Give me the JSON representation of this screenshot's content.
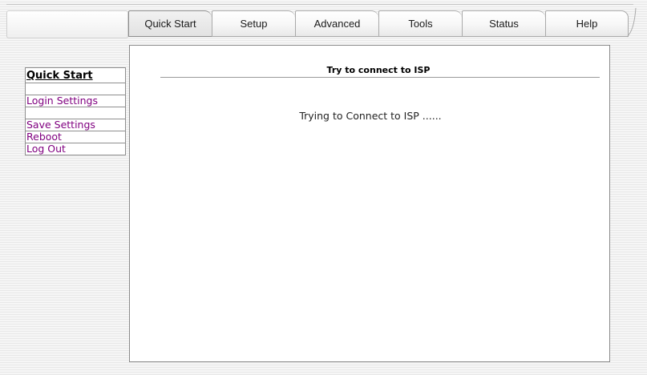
{
  "tabs": [
    {
      "label": "Quick Start",
      "active": true
    },
    {
      "label": "Setup",
      "active": false
    },
    {
      "label": "Advanced",
      "active": false
    },
    {
      "label": "Tools",
      "active": false
    },
    {
      "label": "Status",
      "active": false
    },
    {
      "label": "Help",
      "active": false
    }
  ],
  "sidebar": {
    "heading": "Quick Start",
    "items": [
      {
        "label": "Login Settings"
      },
      {
        "label": "Save Settings"
      },
      {
        "label": "Reboot"
      },
      {
        "label": "Log Out"
      }
    ]
  },
  "main": {
    "title": "Try to connect to ISP",
    "status_message": "Trying to Connect to ISP ......"
  },
  "colors": {
    "link": "#800080",
    "panel_border": "#8a8a8a"
  }
}
